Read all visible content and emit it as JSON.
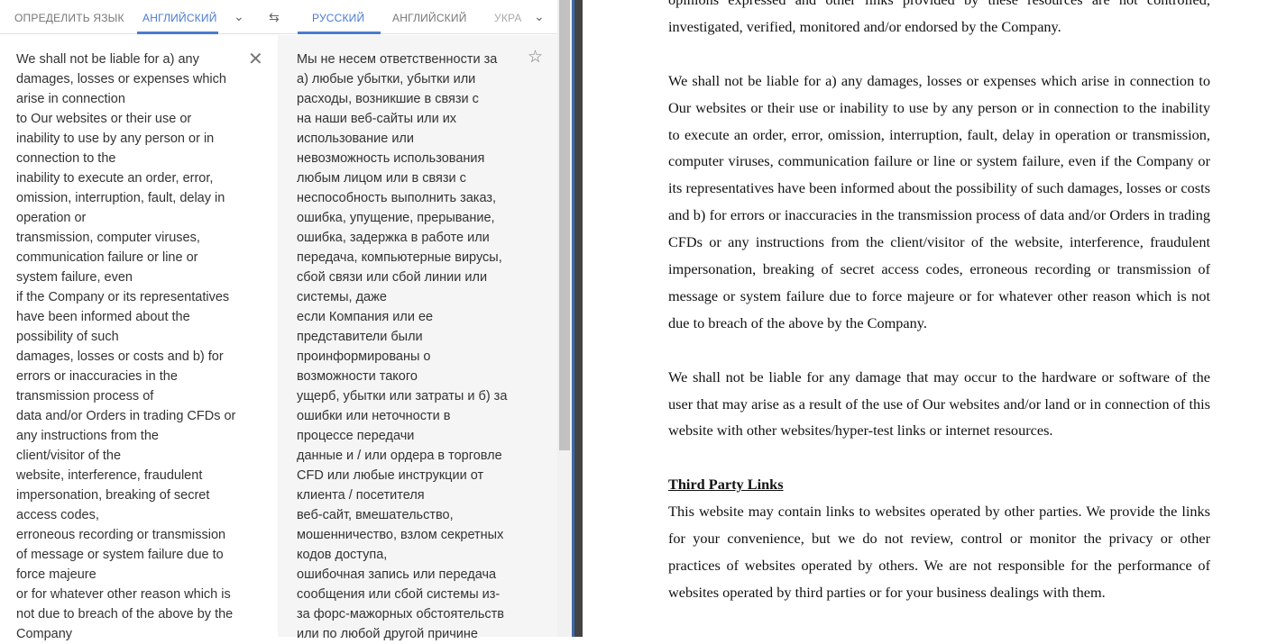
{
  "translator": {
    "source_tabs": [
      "ОПРЕДЕЛИТЬ ЯЗЫК",
      "АНГЛИЙСКИЙ"
    ],
    "target_tabs": [
      "РУССКИЙ",
      "АНГЛИЙСКИЙ",
      "УКРА"
    ],
    "accent": "#4a7bd0",
    "source_lines": [
      "We shall not be liable for a) any",
      "damages, losses or expenses which",
      "arise in connection",
      "to Our websites or their use or",
      "inability to use by any person or in",
      "connection to the",
      "inability to execute an order, error,",
      "omission, interruption, fault, delay in",
      "operation or",
      "transmission, computer viruses,",
      "communication failure or line or",
      "system failure, even",
      "if the Company or its representatives",
      "have been informed about the",
      "possibility of such",
      "damages, losses or costs and b) for",
      "errors or inaccuracies in the",
      "transmission process of",
      "data and/or Orders in trading CFDs or",
      "any instructions from the",
      "client/visitor of the",
      "website, interference, fraudulent",
      "impersonation, breaking of secret",
      "access codes,",
      "erroneous recording or transmission",
      "of message or system failure due to",
      "force majeure",
      "or for whatever other reason which is",
      "not due to breach of the above by the",
      "Company"
    ],
    "target_lines": [
      "Мы не несем ответственности за",
      "а) любые убытки, убытки или",
      "расходы, возникшие в связи с",
      "на наши веб-сайты или их",
      "использование или",
      "невозможность использования",
      "любым лицом или в связи с",
      "неспособность выполнить заказ,",
      "ошибка, упущение, прерывание,",
      "ошибка, задержка в работе или",
      "передача, компьютерные вирусы,",
      "сбой связи или сбой линии или",
      "системы, даже",
      "если Компания или ее",
      "представители были",
      "проинформированы о",
      "возможности такого",
      "ущерб, убытки или затраты и б) за",
      "ошибки или неточности в",
      "процессе передачи",
      "данные и / или ордера в торговле",
      "CFD или любые инструкции от",
      "клиента / посетителя",
      "веб-сайт, вмешательство,",
      "мошенничество, взлом секретных",
      "кодов доступа,",
      "ошибочная запись или передача",
      "сообщения или сбой системы из-",
      "за форс-мажорных обстоятельств",
      "или по любой другой причине"
    ]
  },
  "document": {
    "p0": "opinions expressed and other links provided by these resources are not controlled, investigated, verified, monitored and/or endorsed by the Company.",
    "p1": "We shall not be liable for a) any damages, losses or expenses which arise in connection to Our websites or their use or inability to use by any person or in connection to the inability to execute an order, error, omission, interruption, fault, delay in operation or transmission, computer viruses, communication failure or line or system failure, even if the Company or its representatives have been informed about the possibility of such damages, losses or costs and b) for errors or inaccuracies in the transmission process of data and/or Orders in trading CFDs or any instructions from the client/visitor of the website, interference, fraudulent impersonation, breaking of secret access codes, erroneous recording or transmission of message or system failure due to force majeure or for whatever other reason which is not due to breach of the above  by the Company.",
    "p2": "We shall not be liable for any damage that may occur to the hardware or software of the user that may arise as a result of the use of Our websites and/or land or in connection of this website with other websites/hyper-test links or internet resources.",
    "heading": "Third Party Links",
    "p3": "This website may contain links to websites operated by other parties. We provide the links for your convenience, but we do not review, control or monitor the privacy or other practices of websites operated by others. We are not responsible for the performance of websites operated by third parties or for your business dealings with them."
  }
}
